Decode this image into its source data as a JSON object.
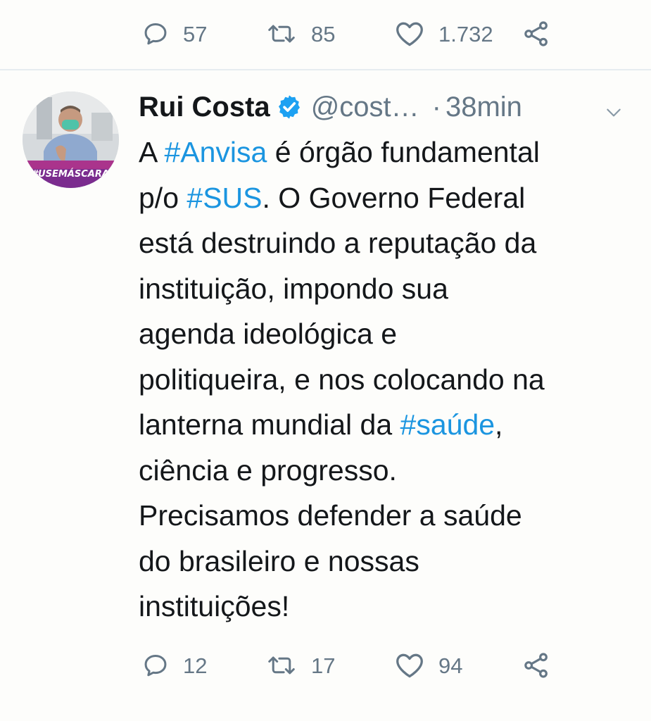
{
  "previous_tweet": {
    "actions": {
      "reply_count": "57",
      "retweet_count": "85",
      "like_count": "1.732"
    }
  },
  "tweet": {
    "author": {
      "display_name": "Rui Costa",
      "handle": "@cost…",
      "avatar_banner_text": "#USEMÁSCARA"
    },
    "separator": "·",
    "timestamp": "38min",
    "text_lines": [
      [
        {
          "t": "A "
        },
        {
          "t": "#Anvisa",
          "tag": true
        },
        {
          "t": " é órgão fundamental"
        }
      ],
      [
        {
          "t": "p/o "
        },
        {
          "t": "#SUS",
          "tag": true
        },
        {
          "t": ". O Governo Federal"
        }
      ],
      [
        {
          "t": "está destruindo a reputação da"
        }
      ],
      [
        {
          "t": "instituição, impondo sua"
        }
      ],
      [
        {
          "t": "agenda ideológica e"
        }
      ],
      [
        {
          "t": "politiqueira, e nos colocando na"
        }
      ],
      [
        {
          "t": "lanterna mundial da "
        },
        {
          "t": "#saúde",
          "tag": true
        },
        {
          "t": ","
        }
      ],
      [
        {
          "t": "ciência e progresso."
        }
      ],
      [
        {
          "t": "Precisamos defender a saúde"
        }
      ],
      [
        {
          "t": "do brasileiro e nossas"
        }
      ],
      [
        {
          "t": "instituições!"
        }
      ]
    ],
    "actions": {
      "reply_count": "12",
      "retweet_count": "17",
      "like_count": "94"
    }
  },
  "icons": {
    "reply": "reply-icon",
    "retweet": "retweet-icon",
    "like": "heart-icon",
    "share": "share-icon",
    "verified": "verified-badge-icon",
    "caret": "chevron-down-icon"
  },
  "colors": {
    "background": "#fdfdfb",
    "text": "#14171a",
    "secondary": "#657786",
    "link": "#1b95e0",
    "verified": "#1da1f2",
    "divider": "#e6ecf0"
  }
}
